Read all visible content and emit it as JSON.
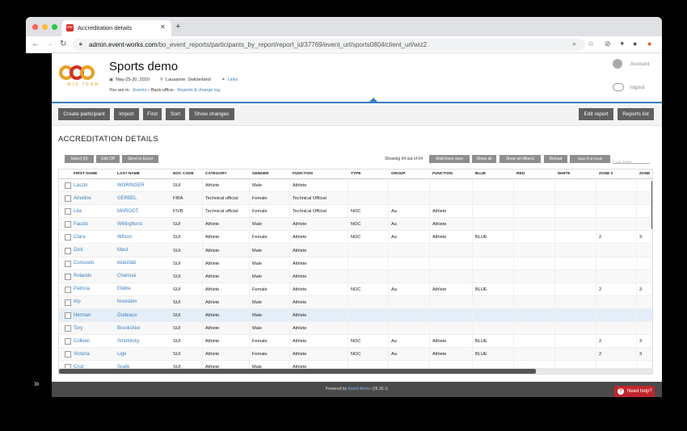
{
  "browser": {
    "tab_title": "Accreditation details",
    "tab_favicon": "ew",
    "url_host": "admin.event-works.com",
    "url_path": "/bo_event_reports/participants_by_report/report_id/37769/event_url/sports0804/client_url/wiz2"
  },
  "event": {
    "title": "Sports demo",
    "dates": "May-25-30, 2020",
    "location": "Lausanne, Switzerland",
    "links_label": "Links",
    "logo_text": "WIZ TEAM"
  },
  "breadcrumb": {
    "prefix": "You are in:",
    "items": [
      "Events",
      "Back-office",
      "Reports & change log"
    ]
  },
  "user": {
    "account_label": "Account",
    "logout_label": "logout"
  },
  "actions": {
    "create_participant": "Create participant",
    "import": "Import",
    "find": "Find",
    "sort": "Sort",
    "show_changes": "Show changes",
    "edit_report": "Edit report",
    "reports_list": "Reports list"
  },
  "section_title": "ACCREDITATION DETAILS",
  "grid_toolbar": {
    "select": "Select (0)",
    "edit_off": "Edit Off",
    "send_excel": "Send to Excel",
    "showing": "Showing 64 out of 64",
    "multi_lines": "Multi lines view",
    "show_all": "Show all",
    "show_all_filters": "Show all (filters)",
    "reload": "Reload",
    "save_find": "Save find result",
    "live_filter_placeholder": "Live filter"
  },
  "columns": [
    "FIRST NAME",
    "LAST NAME",
    "NOC CODE",
    "CATEGORY",
    "GENDER",
    "FUNCTION",
    "TYPE",
    "GROUP",
    "FUNCTION",
    "BLUE",
    "RED",
    "WHITE",
    "ZONE 2",
    "ZONE"
  ],
  "rows": [
    [
      "Laszlo",
      "WORINGER",
      "SUI",
      "Athlete",
      "Male",
      "Athlete",
      "",
      "",
      "",
      "",
      "",
      "",
      "",
      ""
    ],
    [
      "Ameline",
      "GERBEL",
      "FIBA",
      "Technical official",
      "Female",
      "Technical Official",
      "",
      "",
      "",
      "",
      "",
      "",
      "",
      ""
    ],
    [
      "Léa",
      "MARGOT",
      "FIVB",
      "Technical official",
      "Female",
      "Technical Official",
      "NOC",
      "Aa",
      "Athlete",
      "",
      "",
      "",
      "",
      ""
    ],
    [
      "Fausto",
      "Willinghurst",
      "SUI",
      "Athlete",
      "Male",
      "Athlete",
      "NOC",
      "Aa",
      "Athlete",
      "",
      "",
      "",
      "",
      ""
    ],
    [
      "Clara",
      "Wilson",
      "SUI",
      "Athlete",
      "Female",
      "Athlete",
      "NOC",
      "Aa",
      "Athlete",
      "BLUE",
      "",
      "",
      "2",
      "3"
    ],
    [
      "Dick",
      "Maul",
      "SUI",
      "Athlete",
      "Male",
      "Athlete",
      "",
      "",
      "",
      "",
      "",
      "",
      "",
      ""
    ],
    [
      "Consuelo",
      "ééàüöâö",
      "SUI",
      "Athlete",
      "Male",
      "Athlete",
      "",
      "",
      "",
      "",
      "",
      "",
      "",
      ""
    ],
    [
      "Rolando",
      "Charisse",
      "SUI",
      "Athlete",
      "Male",
      "Athlete",
      "",
      "",
      "",
      "",
      "",
      "",
      "",
      ""
    ],
    [
      "Patricia",
      "Ellèbe",
      "SUI",
      "Athlete",
      "Female",
      "Athlete",
      "NOC",
      "Aa",
      "Athlete",
      "BLUE",
      "",
      "",
      "2",
      "3"
    ],
    [
      "Kip",
      "Noordàm",
      "SUI",
      "Athlete",
      "Male",
      "Athlete",
      "",
      "",
      "",
      "",
      "",
      "",
      "",
      ""
    ],
    [
      "Herman",
      "Godeaux",
      "SUI",
      "Athlete",
      "Male",
      "Athlete",
      "",
      "",
      "",
      "",
      "",
      "",
      "",
      ""
    ],
    [
      "Tory",
      "Brookshier",
      "SUI",
      "Athlete",
      "Male",
      "Athlete",
      "",
      "",
      "",
      "",
      "",
      "",
      "",
      ""
    ],
    [
      "Colleen",
      "Smolnicky",
      "SUI",
      "Athlete",
      "Female",
      "Athlete",
      "NOC",
      "Aa",
      "Athlete",
      "BLUE",
      "",
      "",
      "2",
      "3"
    ],
    [
      "Victoria",
      "Lige",
      "SUI",
      "Athlete",
      "Female",
      "Athlete",
      "NOC",
      "Aa",
      "Athlete",
      "BLUE",
      "",
      "",
      "2",
      "3"
    ],
    [
      "Cruz",
      "Scafe",
      "SUI",
      "Athlete",
      "Male",
      "Athlete",
      "",
      "",
      "",
      "",
      "",
      "",
      "",
      ""
    ]
  ],
  "footer": {
    "prefix": "Powered by",
    "brand": "Event Works",
    "version": "(26.30.1)"
  },
  "help_label": "Need help?",
  "colors": {
    "accent": "#3a7fc1",
    "button": "#606060",
    "help": "#c0262b",
    "logo": "#e8a020"
  }
}
